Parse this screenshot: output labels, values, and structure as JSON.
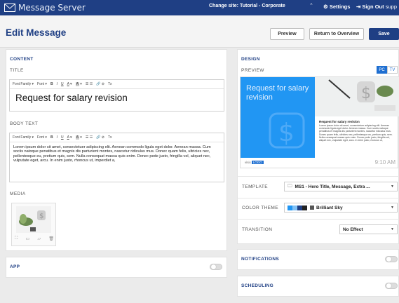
{
  "app": {
    "title": "Message Server"
  },
  "topbar": {
    "site": "Change site: Tutorial - Corporate",
    "site_arrow": "⌃",
    "settings": "Settings",
    "sign_out": "Sign Out",
    "user": "supp"
  },
  "header": {
    "title": "Edit Message",
    "preview": "Preview",
    "return": "Return to Overview",
    "save": "Save"
  },
  "content": {
    "heading": "CONTENT",
    "title_label": "TITLE",
    "title_value": "Request for salary revision",
    "toolbar": {
      "font_family": "Font Family",
      "font": "Font",
      "bold": "B",
      "italic": "I",
      "underline": "U",
      "color": "A",
      "highlight": "A",
      "list": "☰ ☷",
      "link": "🔗 ⊘",
      "clear": "Tx"
    },
    "body_label": "BODY TEXT",
    "body_value": "Lorem ipsum dolor sit amet, consectetuer adipiscing elit. Aenean commodo ligula eget dolor. Aenean massa. Cum sociis natoque penatibus et magnis dis parturient montes, nascetur ridiculus mus. Donec quam felis, ultricies nec, pellentesque eu, pretium quis, sem. Nulla consequat massa quis enim. Donec pede justo, fringilla vel, aliquet nec, vulputate eget, arcu. In enim justo, rhoncus ut, imperdiet a,",
    "media_label": "MEDIA"
  },
  "app_section": {
    "heading": "APP"
  },
  "design": {
    "heading": "DESIGN",
    "preview_label": "PREVIEW",
    "pc": "PC",
    "tv": "TV",
    "preview_title": "Request for salary revision",
    "preview_msg_title": "Request for salary revision",
    "preview_msg": "Lorem ipsum dolor sit amet, consectetuer adipiscing elit. Aenean commodo ligula eget dolor. Aenean massa. Cum sociis natoque penatibus et magnis dis parturient montes, nascetur ridiculus mus. Donec quam felis, ultricies nec, pellentesque eu, pretium quis, sem. Nulla consequat massa quis enim. Donec pede justo, fringilla vel, aliquet nec, vulputate eget, arcu. In enim justo, rhoncus ut,",
    "visix": "visix",
    "visix_badge": "LOGO",
    "time": "9:10 AM",
    "template_label": "TEMPLATE",
    "template_value": "MS1 - Hero Title, Message, Extra ...",
    "theme_label": "COLOR THEME",
    "theme_value": "Brilliant Sky",
    "transition_label": "TRANSITION",
    "transition_value": "No Effect",
    "notifications": "NOTIFICATIONS",
    "scheduling": "SCHEDULING"
  },
  "colors": {
    "brand": "#1f3f84",
    "preview_blue": "#2196f3"
  }
}
